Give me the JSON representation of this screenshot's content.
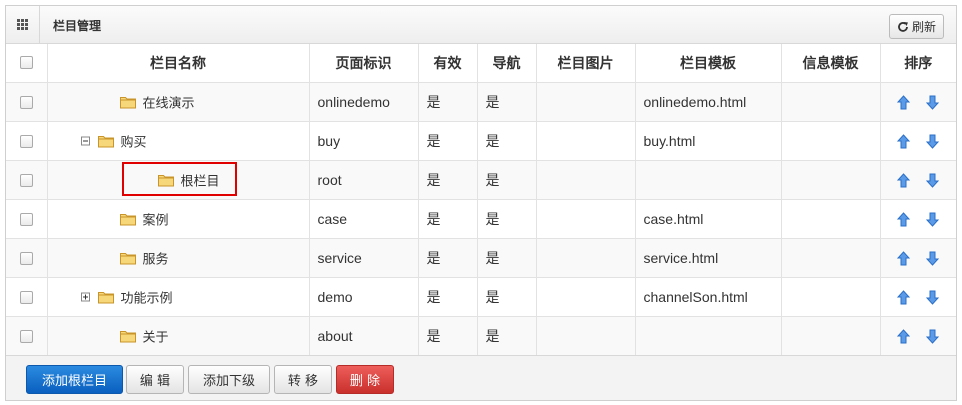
{
  "header": {
    "title": "栏目管理",
    "refresh_label": "刷新"
  },
  "columns": [
    "栏目名称",
    "页面标识",
    "有效",
    "导航",
    "栏目图片",
    "栏目模板",
    "信息模板",
    "排序"
  ],
  "rows": [
    {
      "name": "在线演示",
      "code": "onlinedemo",
      "valid": "是",
      "nav": "是",
      "image": "",
      "template": "onlinedemo.html",
      "info_template": ""
    },
    {
      "name": "购买",
      "code": "buy",
      "valid": "是",
      "nav": "是",
      "image": "",
      "template": "buy.html",
      "info_template": ""
    },
    {
      "name": "根栏目",
      "code": "root",
      "valid": "是",
      "nav": "是",
      "image": "",
      "template": "",
      "info_template": ""
    },
    {
      "name": "案例",
      "code": "case",
      "valid": "是",
      "nav": "是",
      "image": "",
      "template": "case.html",
      "info_template": ""
    },
    {
      "name": "服务",
      "code": "service",
      "valid": "是",
      "nav": "是",
      "image": "",
      "template": "service.html",
      "info_template": ""
    },
    {
      "name": "功能示例",
      "code": "demo",
      "valid": "是",
      "nav": "是",
      "image": "",
      "template": "channelSon.html",
      "info_template": ""
    },
    {
      "name": "关于",
      "code": "about",
      "valid": "是",
      "nav": "是",
      "image": "",
      "template": "",
      "info_template": ""
    }
  ],
  "footer": {
    "add_root_label": "添加根栏目",
    "edit_label": "编 辑",
    "add_child_label": "添加下级",
    "move_label": "转 移",
    "delete_label": "删 除"
  },
  "colors": {
    "primary": "#1a73d0",
    "danger": "#d9534f",
    "highlight": "#e00000",
    "arrow": "#2a6fc9",
    "folder": "#f2c14e"
  }
}
